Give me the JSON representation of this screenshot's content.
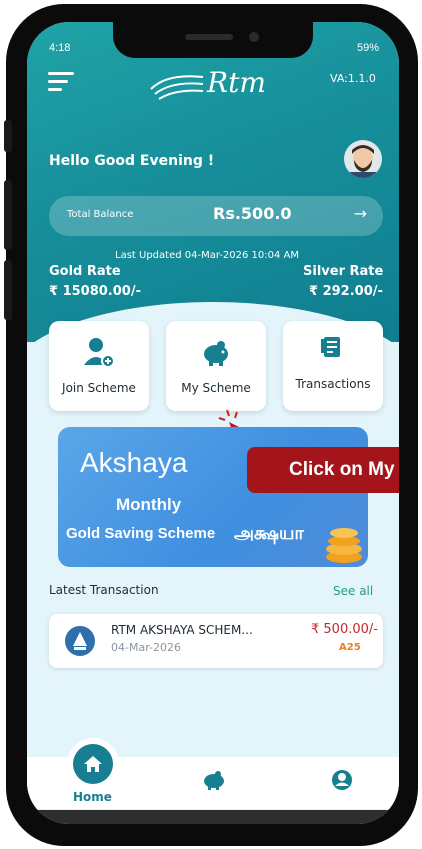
{
  "status_bar": {
    "time": "4:18",
    "battery": "59%"
  },
  "header": {
    "logo_text": "Rtm",
    "version": "VA:1.1.0"
  },
  "greeting": "Hello Good Evening !",
  "balance": {
    "label": "Total Balance",
    "amount": "Rs.500.0",
    "arrow": "→"
  },
  "last_updated": "Last Updated 04-Mar-2026 10:04 AM",
  "rates": {
    "gold_label": "Gold Rate",
    "gold_value": "₹ 15080.00/-",
    "silver_label": "Silver Rate",
    "silver_value": "₹ 292.00/-"
  },
  "actions": [
    {
      "label": "Join Scheme",
      "icon": "join-scheme-icon"
    },
    {
      "label": "My Scheme",
      "icon": "piggy-bank-icon"
    },
    {
      "label": "Transactions",
      "icon": "receipt-icon"
    }
  ],
  "banner": {
    "title": "Akshaya",
    "line1": "Monthly",
    "line2": "Gold Saving Scheme",
    "tamil": "அக்ஷயா"
  },
  "callout": "Click on My",
  "latest": {
    "title": "Latest Transaction",
    "see_all": "See all",
    "items": [
      {
        "name": "RTM AKSHAYA SCHEM...",
        "date": "04-Mar-2026",
        "amount": "₹ 500.00/-",
        "code": "A25"
      }
    ]
  },
  "bottom_nav": {
    "home_label": "Home"
  },
  "colors": {
    "teal": "#187f93",
    "callout_red": "#a3151b",
    "amount_red": "#c22a2a",
    "code_orange": "#e8821a",
    "see_all_green": "#23a07a"
  }
}
